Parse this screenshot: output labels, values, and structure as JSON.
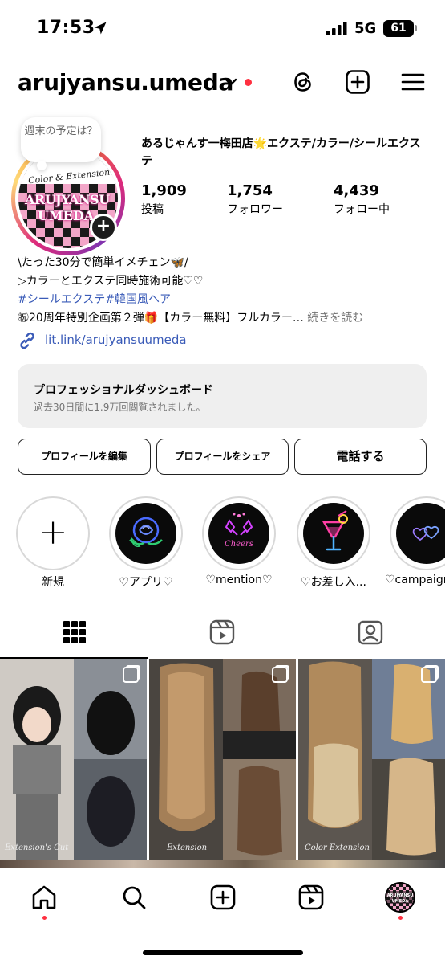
{
  "status_bar": {
    "time": "17:53",
    "network": "5G",
    "battery": "61"
  },
  "header": {
    "username": "arujyansu.umeda"
  },
  "note": {
    "text": "週末の予定は？"
  },
  "avatar": {
    "line_sub": "Color & Extension",
    "line1": "ARUJYANSU",
    "line2": "UMEDA"
  },
  "profile": {
    "display_name": "あるじゃんす一梅田店🌟エクステ/カラー/シールエクステ",
    "stats": [
      {
        "value": "1,909",
        "label": "投稿"
      },
      {
        "value": "1,754",
        "label": "フォロワー"
      },
      {
        "value": "4,439",
        "label": "フォロー中"
      }
    ]
  },
  "bio": {
    "line1": "\\たった30分で簡単イメチェン🦋/",
    "line2": "▷カラーとエクステ同時施術可能♡♡",
    "line3": "#シールエクステ#韓国風ヘア",
    "line4": "㊗20周年特別企画第２弾🎁【カラー無料】フルカラー…",
    "more": "続きを読む",
    "link": "lit.link/arujyansuumeda"
  },
  "dashboard": {
    "title": "プロフェッショナルダッシュボード",
    "subtitle": "過去30日間に1.9万回閲覧されました。"
  },
  "actions": {
    "edit": "プロフィールを編集",
    "share": "プロフィールをシェア",
    "call": "電話する"
  },
  "highlights": [
    {
      "label": "新規"
    },
    {
      "label": "♡アプリ♡"
    },
    {
      "label": "♡mention♡"
    },
    {
      "label": "♡お差し入..."
    },
    {
      "label": "♡campaign"
    }
  ],
  "highlight_art": {
    "cheers": "Cheers"
  },
  "posts": [
    {
      "caption": "Extension's Cut"
    },
    {
      "caption": "Extension"
    },
    {
      "caption": "Color Extension"
    }
  ],
  "nav_avatar": {
    "line1": "ARUJYANSU",
    "line2": "UMEDA"
  },
  "colors": {
    "accent_link": "#3a5bb8",
    "notification": "#ff3040",
    "dashboard_bg": "#efefef"
  }
}
